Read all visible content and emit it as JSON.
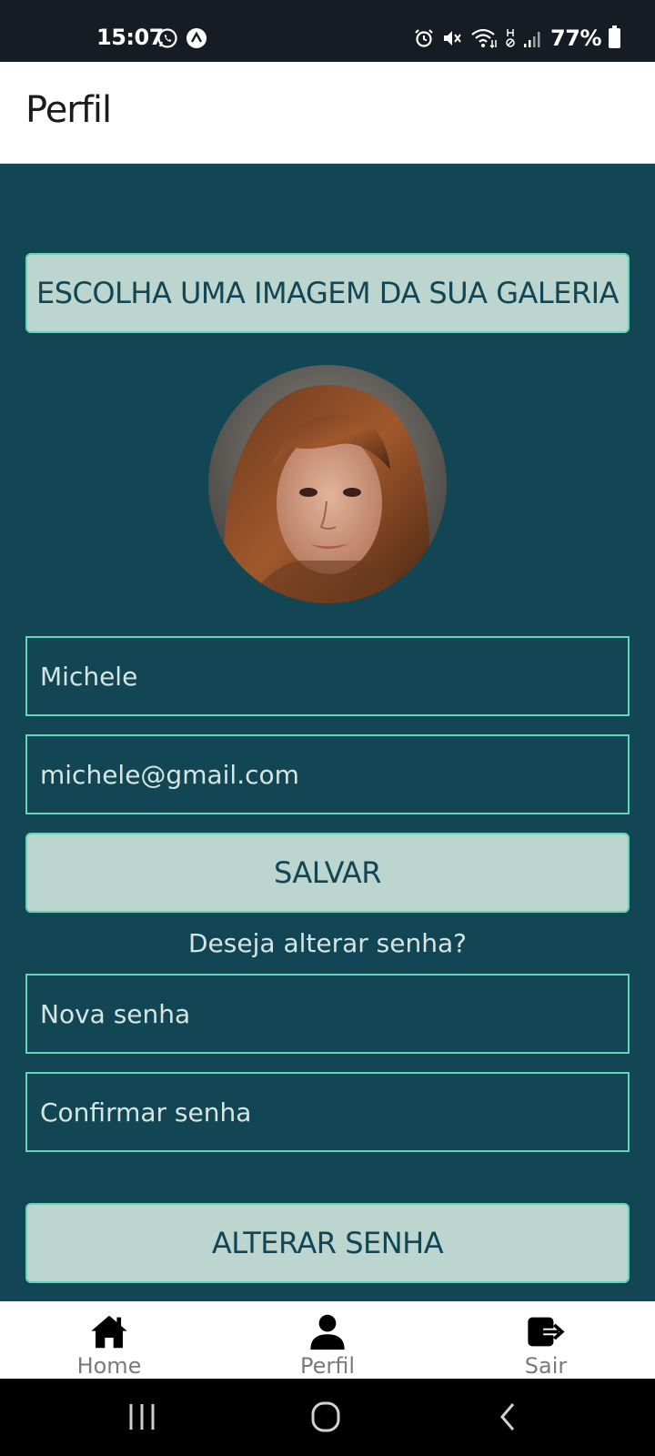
{
  "status_bar": {
    "time": "15:07",
    "battery": "77%",
    "icons": [
      "whatsapp-icon",
      "app-notification-icon",
      "alarm-icon",
      "mute-icon",
      "wifi-icon",
      "signal-icon",
      "battery-icon"
    ]
  },
  "header": {
    "title": "Perfil"
  },
  "profile": {
    "choose_image_label": "ESCOLHA UMA IMAGEM DA SUA GALERIA",
    "avatar": "profile-photo",
    "name_value": "Michele",
    "email_value": "michele@gmail.com",
    "save_label": "SALVAR",
    "change_password_question": "Deseja alterar senha?",
    "new_password_placeholder": "Nova senha",
    "confirm_password_placeholder": "Confirmar senha",
    "change_password_label": "ALTERAR SENHA"
  },
  "bottom_nav": {
    "items": [
      {
        "label": "Home",
        "icon": "home-icon"
      },
      {
        "label": "Perfil",
        "icon": "user-icon"
      },
      {
        "label": "Sair",
        "icon": "logout-icon"
      }
    ]
  },
  "system_nav": {
    "icons": [
      "recent-apps-icon",
      "home-circle-icon",
      "back-icon"
    ]
  },
  "colors": {
    "background": "#124654",
    "button_fill": "#bcd5cf",
    "border_accent": "#5fd6b8",
    "status_bar": "#171b24"
  }
}
